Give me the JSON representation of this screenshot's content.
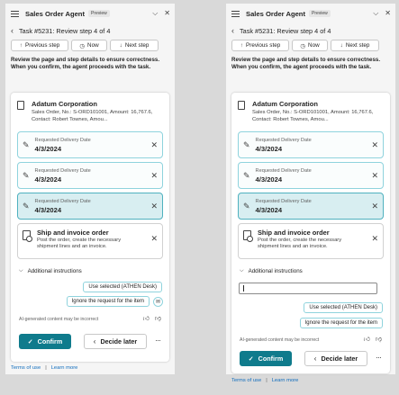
{
  "app": {
    "title": "Sales Order Agent",
    "badge": "Preview",
    "task_title": "Task #5231: Review step 4 of 4"
  },
  "step_buttons": {
    "previous": "Previous step",
    "now": "Now",
    "next": "Next step"
  },
  "review_text": "Review the page and step details to ensure correctness. When you confirm, the agent proceeds with the task.",
  "entity": {
    "name": "Adatum Corporation",
    "desc_left": "Sales Order, No.: S-ORD101001, Amount: 16,767.6, Contact: Robert Townes, Amou...",
    "desc_right": "Sales Order, No.: S-ORD101001, Amount: 16,767.6, Contact: Robert Townes, Amou..."
  },
  "fields": [
    {
      "label": "Requested Delivery Date",
      "value": "4/3/2024"
    },
    {
      "label": "Requested Delivery Date",
      "value": "4/3/2024"
    },
    {
      "label": "Requested Delivery Date",
      "value": "4/3/2024"
    }
  ],
  "ship": {
    "title": "Ship and invoice order",
    "desc": "Post the order, create the necessary shipment lines and an invoice."
  },
  "additional_instructions": "Additional instructions",
  "suggestions": {
    "use_selected": "Use selected (ATHEN Desk)",
    "ignore": "Ignore the request for the item"
  },
  "disclaimer": "AI-generated content may be incorrect",
  "actions": {
    "confirm": "Confirm",
    "decide_later": "Decide later"
  },
  "footer": {
    "terms": "Terms of use",
    "learn_more": "Learn more"
  },
  "icons": {
    "menu": "hamburger-icon",
    "close": "close-icon",
    "more": "more-options-icon"
  },
  "colors": {
    "accent": "#0f7b8c",
    "field_border": "#8fd3dd",
    "field_highlight": "#d8eef1"
  }
}
